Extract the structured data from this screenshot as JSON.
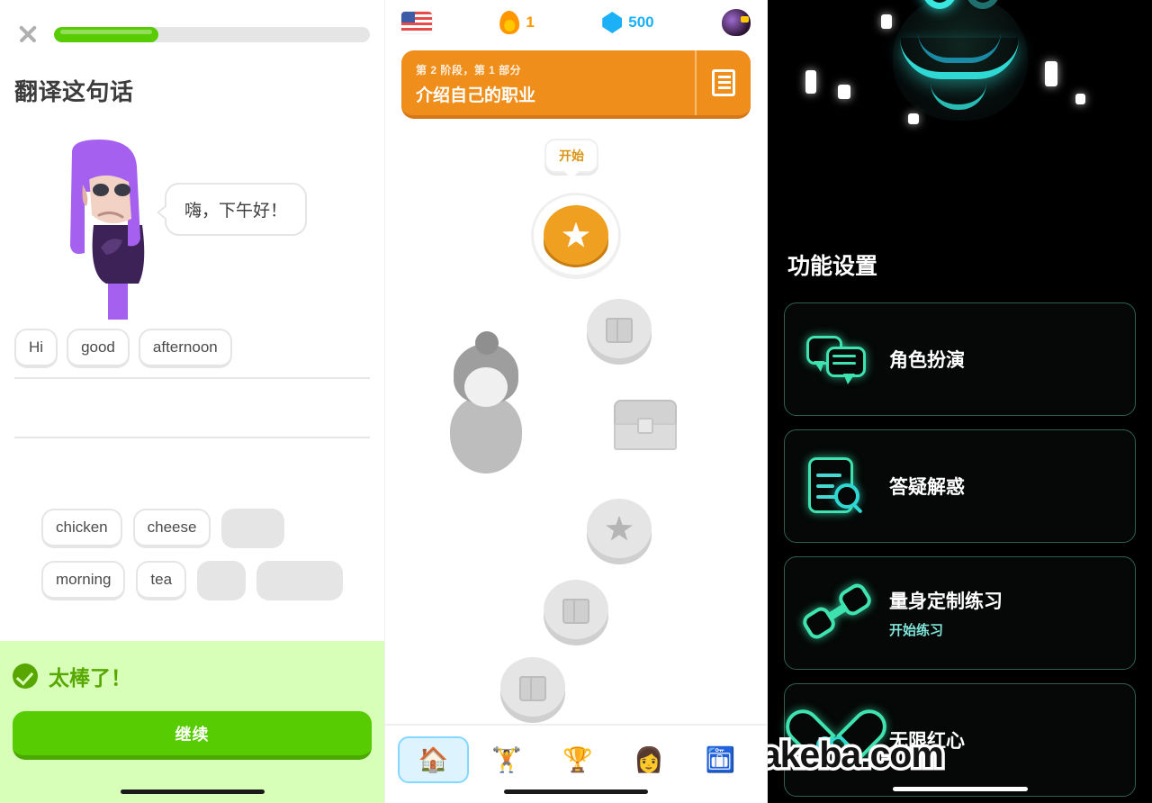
{
  "lesson": {
    "close_icon": "close-icon",
    "progress_percent": 33,
    "title": "翻译这句话",
    "speech": "嗨，下午好！",
    "answer_tiles": [
      "Hi",
      "good",
      "afternoon"
    ],
    "bank_row1": [
      "chicken",
      "cheese",
      ""
    ],
    "bank_row2": [
      "morning",
      "tea",
      "",
      ""
    ],
    "feedback": {
      "icon": "check-circle-icon",
      "text": "太棒了！",
      "continue_label": "继续"
    }
  },
  "path": {
    "status": {
      "flag_icon": "us-flag-icon",
      "streak_icon": "fire-icon",
      "streak_value": "1",
      "gem_icon": "gem-icon",
      "gem_value": "500",
      "avatar_icon": "duo-avatar-icon"
    },
    "unit": {
      "subtitle": "第 2 阶段，第 1 部分",
      "title": "介绍自己的职业",
      "guidebook_icon": "guidebook-icon"
    },
    "start_bubble": "开始",
    "nodes": [
      {
        "name": "node-star-active",
        "icon": "star-icon",
        "state": "active"
      },
      {
        "name": "node-book-1",
        "icon": "book-icon",
        "state": "locked"
      },
      {
        "name": "node-chest",
        "icon": "treasure-chest-icon",
        "state": "locked"
      },
      {
        "name": "node-star-2",
        "icon": "star-icon",
        "state": "locked"
      },
      {
        "name": "node-book-2",
        "icon": "book-icon",
        "state": "locked"
      },
      {
        "name": "node-partial",
        "icon": "dumbbell-icon",
        "state": "locked"
      }
    ],
    "mascot_icon": "lily-mascot-icon",
    "nav": [
      {
        "name": "nav-home",
        "icon": "🏠",
        "selected": true
      },
      {
        "name": "nav-practice",
        "icon": "🏋",
        "selected": false
      },
      {
        "name": "nav-leagues",
        "icon": "🏆",
        "selected": false
      },
      {
        "name": "nav-profile",
        "icon": "👩",
        "selected": false
      },
      {
        "name": "nav-shop",
        "icon": "🛅",
        "selected": false
      }
    ]
  },
  "settings": {
    "hero_icon": "neon-owl-icon",
    "title": "功能设置",
    "cards": [
      {
        "name": "card-roleplay",
        "icon": "neon-chat-icon",
        "title": "角色扮演",
        "sub": ""
      },
      {
        "name": "card-qa",
        "icon": "neon-doc-search-icon",
        "title": "答疑解惑",
        "sub": ""
      },
      {
        "name": "card-practice",
        "icon": "neon-dumbbell-icon",
        "title": "量身定制练习",
        "sub": "开始练习"
      },
      {
        "name": "card-hearts",
        "icon": "neon-infinity-heart-icon",
        "title": "无限红心",
        "sub": ""
      }
    ]
  },
  "watermark": {
    "at": "@",
    "text": "kuakeba.com"
  }
}
